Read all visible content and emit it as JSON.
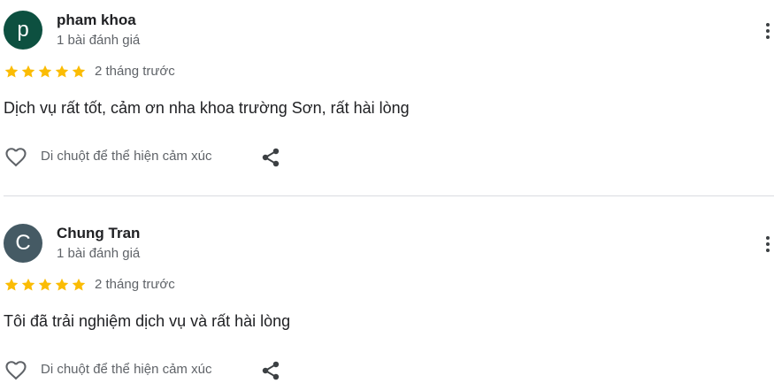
{
  "reviews": [
    {
      "avatar_letter": "p",
      "avatar_color": "#0d5040",
      "name": "pham khoa",
      "review_count": "1 bài đánh giá",
      "rating": 5,
      "date": "2 tháng trước",
      "text": "Dịch vụ rất tốt, cảm ơn nha khoa trường Sơn, rất hài lòng",
      "react_label": "Di chuột để thể hiện cảm xúc",
      "icons": {
        "like": "heart-outline-icon",
        "share": "share-icon",
        "more": "more-vert-icon"
      }
    },
    {
      "avatar_letter": "C",
      "avatar_color": "#455a64",
      "name": "Chung Tran",
      "review_count": "1 bài đánh giá",
      "rating": 5,
      "date": "2 tháng trước",
      "text": "Tôi đã trải nghiệm dịch vụ và rất hài lòng",
      "react_label": "Di chuột để thể hiện cảm xúc",
      "icons": {
        "like": "heart-outline-icon",
        "share": "share-icon",
        "more": "more-vert-icon"
      }
    }
  ],
  "colors": {
    "star": "#fbbc04",
    "divider": "#dadce0",
    "secondary_text": "#5f6368"
  }
}
